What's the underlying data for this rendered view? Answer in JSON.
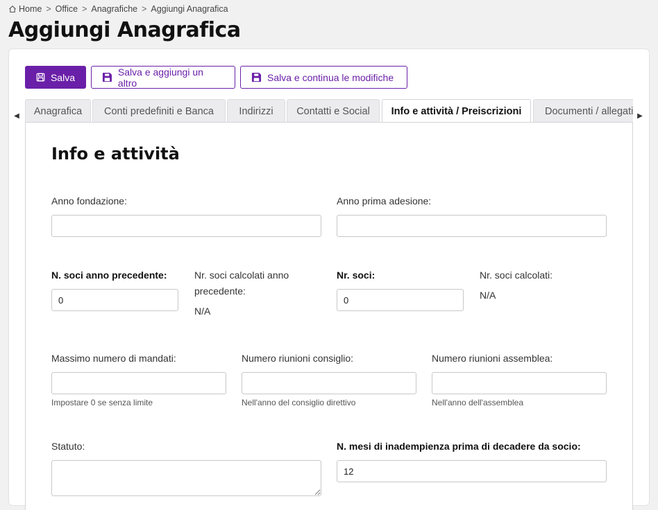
{
  "breadcrumb": {
    "home": "Home",
    "items": [
      "Office",
      "Anagrafiche",
      "Aggiungi Anagrafica"
    ],
    "separator": ">"
  },
  "page": {
    "title": "Aggiungi Anagrafica"
  },
  "toolbar": {
    "save_label": "Salva",
    "save_add_label": "Salva e aggiungi un altro",
    "save_continue_label": "Salva e continua le modifiche"
  },
  "tabs": [
    {
      "label": "Anagrafica",
      "active": false
    },
    {
      "label": "Conti predefiniti e Banca",
      "active": false
    },
    {
      "label": "Indirizzi",
      "active": false
    },
    {
      "label": "Contatti e Social",
      "active": false
    },
    {
      "label": "Info e attività / Preiscrizioni",
      "active": true
    },
    {
      "label": "Documenti / allegati",
      "active": false
    }
  ],
  "section": {
    "title": "Info e attività"
  },
  "form": {
    "anno_fondazione": {
      "label": "Anno fondazione:",
      "value": ""
    },
    "anno_prima_adesione": {
      "label": "Anno prima adesione:",
      "value": ""
    },
    "n_soci_anno_precedente": {
      "label": "N. soci anno precedente:",
      "value": "0"
    },
    "nr_soci_calcolati_anno_precedente": {
      "label_line1": "Nr. soci calcolati anno",
      "label_line2": "precedente:",
      "value": "N/A"
    },
    "nr_soci": {
      "label": "Nr. soci:",
      "value": "0"
    },
    "nr_soci_calcolati": {
      "label": "Nr. soci calcolati:",
      "value": "N/A"
    },
    "massimo_numero_mandati": {
      "label": "Massimo numero di mandati:",
      "value": "",
      "help": "Impostare 0 se senza limite"
    },
    "numero_riunioni_consiglio": {
      "label": "Numero riunioni consiglio:",
      "value": "",
      "help": "Nell'anno del consiglio direttivo"
    },
    "numero_riunioni_assemblea": {
      "label": "Numero riunioni assemblea:",
      "value": "",
      "help": "Nell'anno dell'assemblea"
    },
    "statuto": {
      "label": "Statuto:",
      "value": ""
    },
    "mesi_inadempienza": {
      "label": "N. mesi di inadempienza prima di decadere da socio:",
      "value": "12"
    }
  },
  "colors": {
    "accent": "#6a1fa8"
  }
}
